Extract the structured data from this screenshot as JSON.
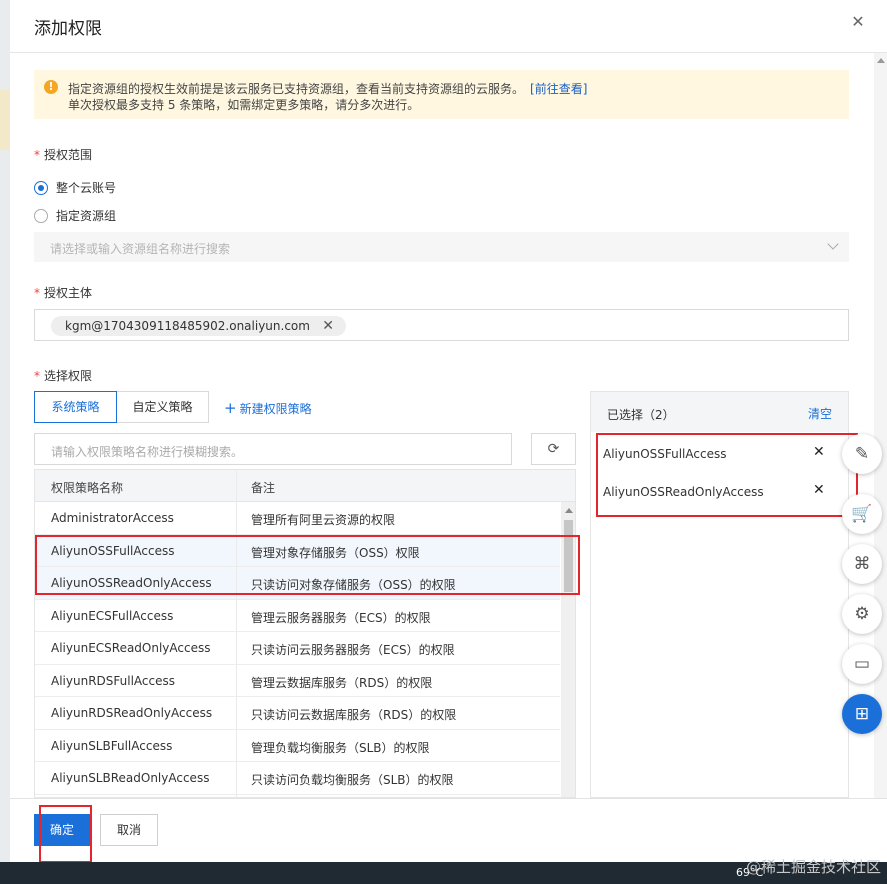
{
  "dialog": {
    "title": "添加权限",
    "close_icon": "close-icon"
  },
  "notice": {
    "icon": "warning-icon",
    "line1": "指定资源组的授权生效前提是该云服务已支持资源组，查看当前支持资源组的云服务。",
    "link": "[前往查看]",
    "line2": "单次授权最多支持 5 条策略，如需绑定更多策略，请分多次进行。"
  },
  "scope": {
    "label": "授权范围",
    "options": [
      {
        "label": "整个云账号",
        "selected": true
      },
      {
        "label": "指定资源组",
        "selected": false
      }
    ],
    "resource_group_placeholder": "请选择或输入资源组名称进行搜索"
  },
  "principal": {
    "label": "授权主体",
    "tag": "kgm@1704309118485902.onaliyun.com"
  },
  "permissions": {
    "label": "选择权限",
    "tabs": [
      "系统策略",
      "自定义策略"
    ],
    "new_policy": "新建权限策略",
    "search_placeholder": "请输入权限策略名称进行模糊搜索。",
    "columns": [
      "权限策略名称",
      "备注"
    ],
    "rows": [
      {
        "name": "AdministratorAccess",
        "note": "管理所有阿里云资源的权限",
        "selected": false
      },
      {
        "name": "AliyunOSSFullAccess",
        "note": "管理对象存储服务（OSS）权限",
        "selected": true
      },
      {
        "name": "AliyunOSSReadOnlyAccess",
        "note": "只读访问对象存储服务（OSS）的权限",
        "selected": true
      },
      {
        "name": "AliyunECSFullAccess",
        "note": "管理云服务器服务（ECS）的权限",
        "selected": false
      },
      {
        "name": "AliyunECSReadOnlyAccess",
        "note": "只读访问云服务器服务（ECS）的权限",
        "selected": false
      },
      {
        "name": "AliyunRDSFullAccess",
        "note": "管理云数据库服务（RDS）的权限",
        "selected": false
      },
      {
        "name": "AliyunRDSReadOnlyAccess",
        "note": "只读访问云数据库服务（RDS）的权限",
        "selected": false
      },
      {
        "name": "AliyunSLBFullAccess",
        "note": "管理负载均衡服务（SLB）的权限",
        "selected": false
      },
      {
        "name": "AliyunSLBReadOnlyAccess",
        "note": "只读访问负载均衡服务（SLB）的权限",
        "selected": false
      }
    ]
  },
  "selected_panel": {
    "title": "已选择（2）",
    "clear": "清空",
    "items": [
      "AliyunOSSFullAccess",
      "AliyunOSSReadOnlyAccess"
    ]
  },
  "footer": {
    "ok": "确定",
    "cancel": "取消"
  },
  "floating_tools": [
    "edit-icon",
    "cart-icon",
    "api-icon",
    "settings-icon",
    "chat-icon",
    "apps-icon"
  ],
  "taskbar": {
    "temperature": "69°C",
    "watermark": "@稀土掘金技术社区"
  },
  "colors": {
    "primary": "#1a6fd8",
    "highlight": "#e3262e",
    "notice_bg": "#fff7e0"
  }
}
